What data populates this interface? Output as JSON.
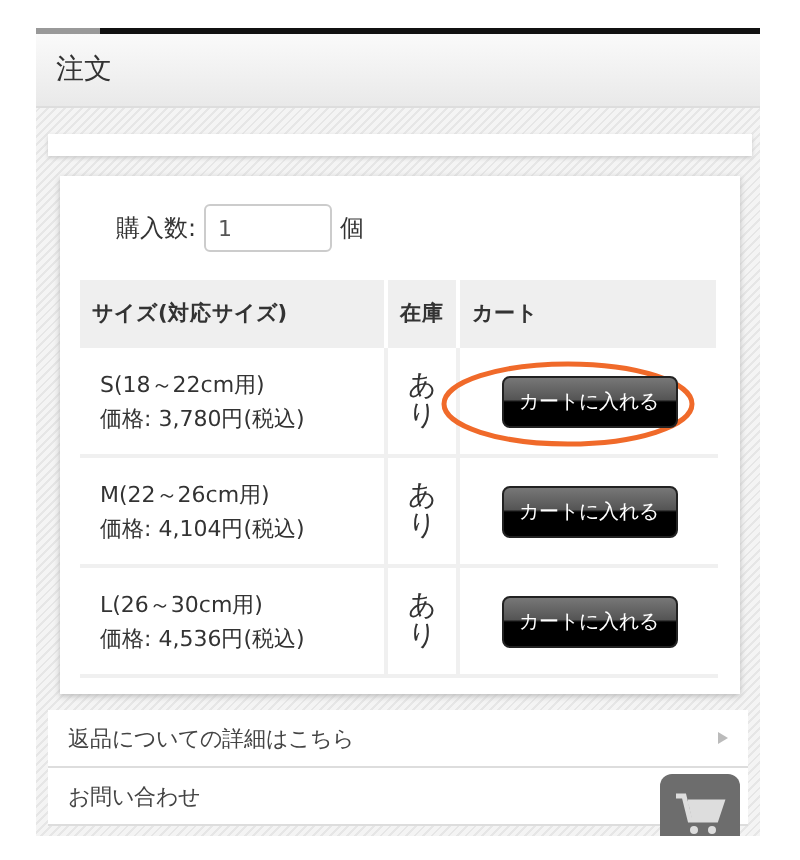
{
  "header": {
    "title": "注文"
  },
  "quantity": {
    "label": "購入数:",
    "value": "1",
    "unit": "個"
  },
  "table": {
    "columns": [
      "サイズ(対応サイズ)",
      "在庫",
      "カート"
    ],
    "rows": [
      {
        "size": "S(18～22cm用)",
        "price": "価格: 3,780円(税込)",
        "stock": "あり",
        "button": "カートに入れる",
        "highlighted": true
      },
      {
        "size": "M(22～26cm用)",
        "price": "価格: 4,104円(税込)",
        "stock": "あり",
        "button": "カートに入れる",
        "highlighted": false
      },
      {
        "size": "L(26～30cm用)",
        "price": "価格: 4,536円(税込)",
        "stock": "あり",
        "button": "カートに入れる",
        "highlighted": false
      }
    ]
  },
  "links": [
    {
      "label": "返品についての詳細はこちら"
    },
    {
      "label": "お問い合わせ"
    }
  ]
}
